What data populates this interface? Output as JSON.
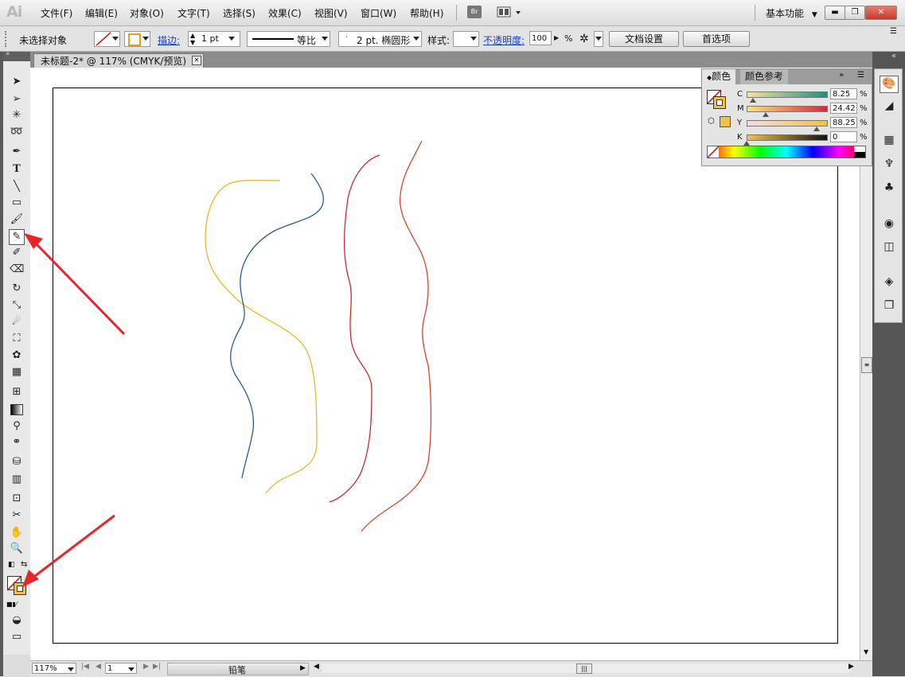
{
  "app": {
    "logo": "Ai"
  },
  "menubar": {
    "items": [
      "文件(F)",
      "编辑(E)",
      "对象(O)",
      "文字(T)",
      "选择(S)",
      "效果(C)",
      "视图(V)",
      "窗口(W)",
      "帮助(H)"
    ],
    "bridge_label": "Br",
    "workspace_label": "基本功能"
  },
  "controlbar": {
    "selection_status": "未选择对象",
    "stroke_label": "描边:",
    "stroke_weight": "1 pt",
    "profile_label": "等比",
    "brush_label": "2 pt. 椭圆形",
    "style_label": "样式:",
    "opacity_label": "不透明度:",
    "opacity_value": "100",
    "opacity_unit": "%",
    "doc_setup_button": "文档设置",
    "preferences_button": "首选项"
  },
  "document": {
    "tab_title": "未标题-2* @ 117% (CMYK/预览)"
  },
  "color_panel": {
    "tab_color": "颜色",
    "tab_color_guide": "颜色参考",
    "channels": [
      {
        "label": "C",
        "value": "8.25",
        "unit": "%",
        "fraction": 0.0825
      },
      {
        "label": "M",
        "value": "24.42",
        "unit": "%",
        "fraction": 0.2442
      },
      {
        "label": "Y",
        "value": "88.25",
        "unit": "%",
        "fraction": 0.8825
      },
      {
        "label": "K",
        "value": "0",
        "unit": "%",
        "fraction": 0
      }
    ]
  },
  "statusbar": {
    "zoom": "117%",
    "page": "1",
    "current_tool": "铅笔"
  },
  "colors": {
    "fill_swatch": "#f2c14a",
    "stroke_yellow": "#e8b72b",
    "stroke_blue": "#2a5b9e",
    "stroke_red": "#c42c2c",
    "stroke_orange_red": "#d2452b",
    "arrow_red": "#e8262a"
  },
  "tools": [
    "selection-tool",
    "direct-selection-tool",
    "magic-wand-tool",
    "lasso-tool",
    "pen-tool",
    "type-tool",
    "line-segment-tool",
    "rectangle-tool",
    "paintbrush-tool",
    "pencil-tool",
    "blob-brush-tool",
    "eraser-tool",
    "rotate-tool",
    "scale-tool",
    "warp-tool",
    "free-transform-tool",
    "symbol-sprayer-tool",
    "column-graph-tool",
    "mesh-tool",
    "gradient-tool",
    "eyedropper-tool",
    "blend-tool",
    "live-paint-bucket-tool",
    "column-chart-tool",
    "artboard-tool",
    "slice-tool",
    "hand-tool",
    "zoom-tool"
  ]
}
